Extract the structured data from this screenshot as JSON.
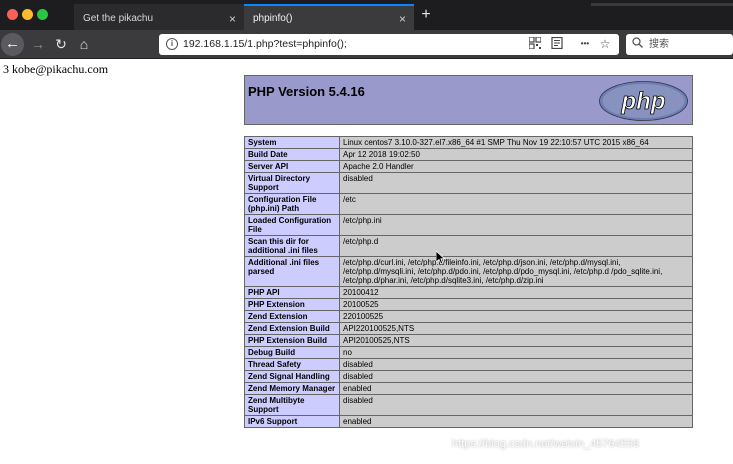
{
  "tabs": [
    {
      "label": "Get the pikachu",
      "close": "×"
    },
    {
      "label": "phpinfo()",
      "close": "×"
    }
  ],
  "new_tab": "+",
  "nav": {
    "back": "←",
    "forward": "→",
    "reload": "↻",
    "home": "⌂",
    "url": "192.168.1.15/1.php?test=phpinfo();",
    "info_icon": "i",
    "menu_dots": "•••",
    "bookmark_star": "☆",
    "search_placeholder": "搜索"
  },
  "page": {
    "output_line": "3 kobe@pikachu.com"
  },
  "phpinfo": {
    "title": "PHP Version 5.4.16",
    "logo_text": "php",
    "rows": [
      {
        "key": "System",
        "value": "Linux centos7 3.10.0-327.el7.x86_64 #1 SMP Thu Nov 19 22:10:57 UTC 2015 x86_64"
      },
      {
        "key": "Build Date",
        "value": "Apr 12 2018 19:02:50"
      },
      {
        "key": "Server API",
        "value": "Apache 2.0 Handler"
      },
      {
        "key": "Virtual Directory Support",
        "value": "disabled"
      },
      {
        "key": "Configuration File (php.ini) Path",
        "value": "/etc"
      },
      {
        "key": "Loaded Configuration File",
        "value": "/etc/php.ini"
      },
      {
        "key": "Scan this dir for additional .ini files",
        "value": "/etc/php.d"
      },
      {
        "key": "Additional .ini files parsed",
        "value": "/etc/php.d/curl.ini, /etc/php.d/fileinfo.ini, /etc/php.d/json.ini, /etc/php.d/mysql.ini, /etc/php.d/mysqli.ini, /etc/php.d/pdo.ini, /etc/php.d/pdo_mysql.ini, /etc/php.d /pdo_sqlite.ini, /etc/php.d/phar.ini, /etc/php.d/sqlite3.ini, /etc/php.d/zip.ini"
      },
      {
        "key": "PHP API",
        "value": "20100412"
      },
      {
        "key": "PHP Extension",
        "value": "20100525"
      },
      {
        "key": "Zend Extension",
        "value": "220100525"
      },
      {
        "key": "Zend Extension Build",
        "value": "API220100525,NTS"
      },
      {
        "key": "PHP Extension Build",
        "value": "API20100525,NTS"
      },
      {
        "key": "Debug Build",
        "value": "no"
      },
      {
        "key": "Thread Safety",
        "value": "disabled"
      },
      {
        "key": "Zend Signal Handling",
        "value": "disabled"
      },
      {
        "key": "Zend Memory Manager",
        "value": "enabled"
      },
      {
        "key": "Zend Multibyte Support",
        "value": "disabled"
      },
      {
        "key": "IPv6 Support",
        "value": "enabled"
      }
    ]
  },
  "watermark": "https://blog.csdn.net/weixin_45764556",
  "colors": {
    "php_header": "#9999cc",
    "key_cell": "#ccccff",
    "value_cell": "#cccccc",
    "tab_accent": "#0a84ff"
  }
}
